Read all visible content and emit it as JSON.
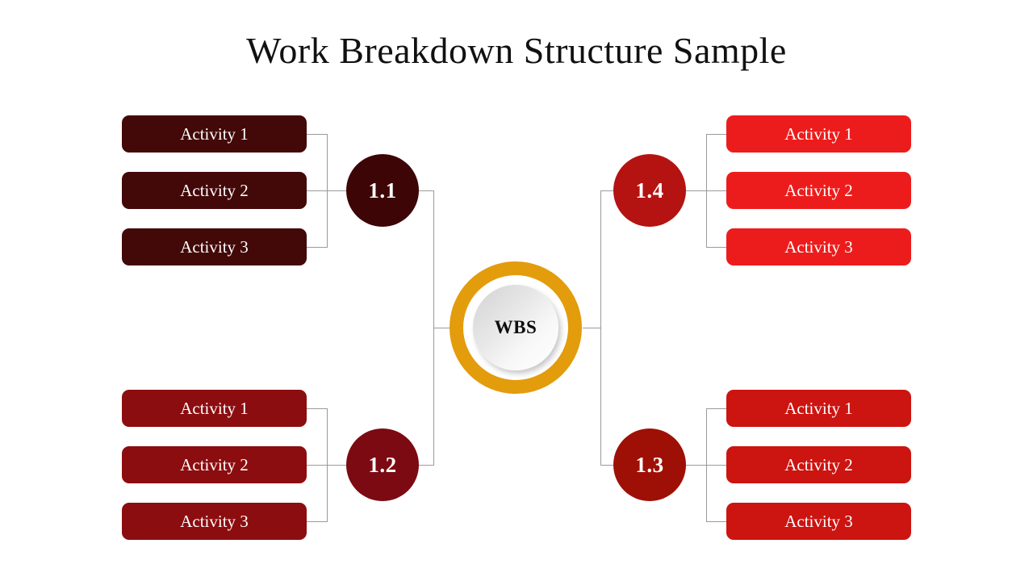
{
  "title": "Work Breakdown Structure Sample",
  "hub": {
    "label": "WBS",
    "ring_color": "#E39C0C",
    "inner_gradient_from": "#d2d2d2",
    "inner_gradient_to": "#ffffff"
  },
  "connector_color": "#9a9a9a",
  "background_color": "#ffffff",
  "branches": [
    {
      "id": "1.1",
      "label": "1.1",
      "position": "top-left",
      "circle_color": "#3D0505",
      "box_color": "#430808",
      "activities": [
        {
          "label": "Activity 1"
        },
        {
          "label": "Activity 2"
        },
        {
          "label": "Activity 3"
        }
      ]
    },
    {
      "id": "1.2",
      "label": "1.2",
      "position": "bottom-left",
      "circle_color": "#7B0A12",
      "box_color": "#8C0D10",
      "activities": [
        {
          "label": "Activity 1"
        },
        {
          "label": "Activity 2"
        },
        {
          "label": "Activity 3"
        }
      ]
    },
    {
      "id": "1.3",
      "label": "1.3",
      "position": "bottom-right",
      "circle_color": "#9E1006",
      "box_color": "#CC1410",
      "activities": [
        {
          "label": "Activity 1"
        },
        {
          "label": "Activity 2"
        },
        {
          "label": "Activity 3"
        }
      ]
    },
    {
      "id": "1.4",
      "label": "1.4",
      "position": "top-right",
      "circle_color": "#B51212",
      "box_color": "#ED1C1C",
      "activities": [
        {
          "label": "Activity 1"
        },
        {
          "label": "Activity 2"
        },
        {
          "label": "Activity 3"
        }
      ]
    }
  ]
}
